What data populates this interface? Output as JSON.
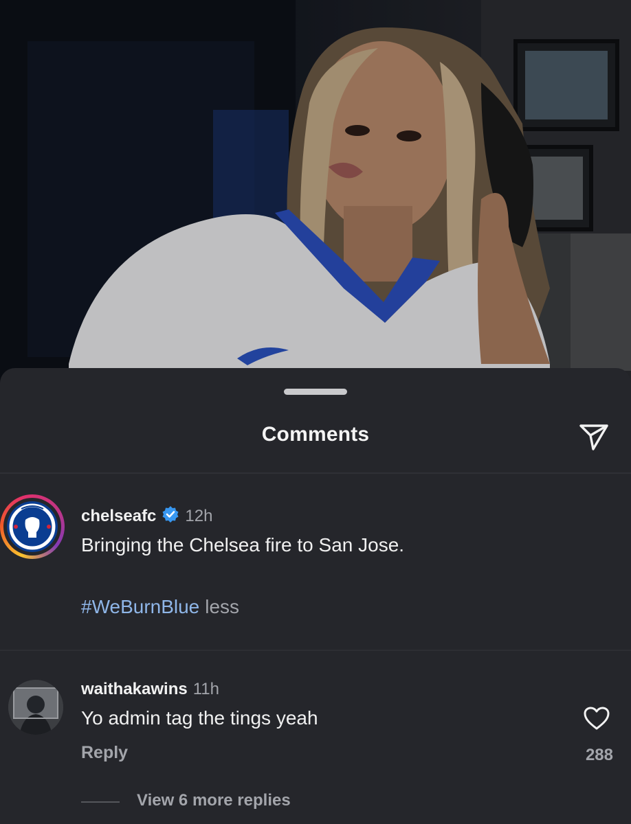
{
  "sheet": {
    "title": "Comments",
    "share_icon": "send-icon"
  },
  "comments": [
    {
      "username": "chelseafc",
      "verified": true,
      "time": "12h",
      "text": "Bringing the Chelsea fire to San Jose.",
      "hashtag": "#WeBurnBlue",
      "less_label": "less",
      "avatar_icon": "chelsea-crest-icon"
    },
    {
      "username": "waithakawins",
      "time": "11h",
      "text": "Yo admin tag the tings yeah",
      "reply_label": "Reply",
      "like_icon": "heart-icon",
      "like_count": "288",
      "view_replies_label": "View 6 more replies"
    }
  ],
  "colors": {
    "background": "#24252a",
    "hashtag": "#8fb6e8",
    "muted_text": "#a3a5ab",
    "verified_badge": "#3897f0"
  }
}
